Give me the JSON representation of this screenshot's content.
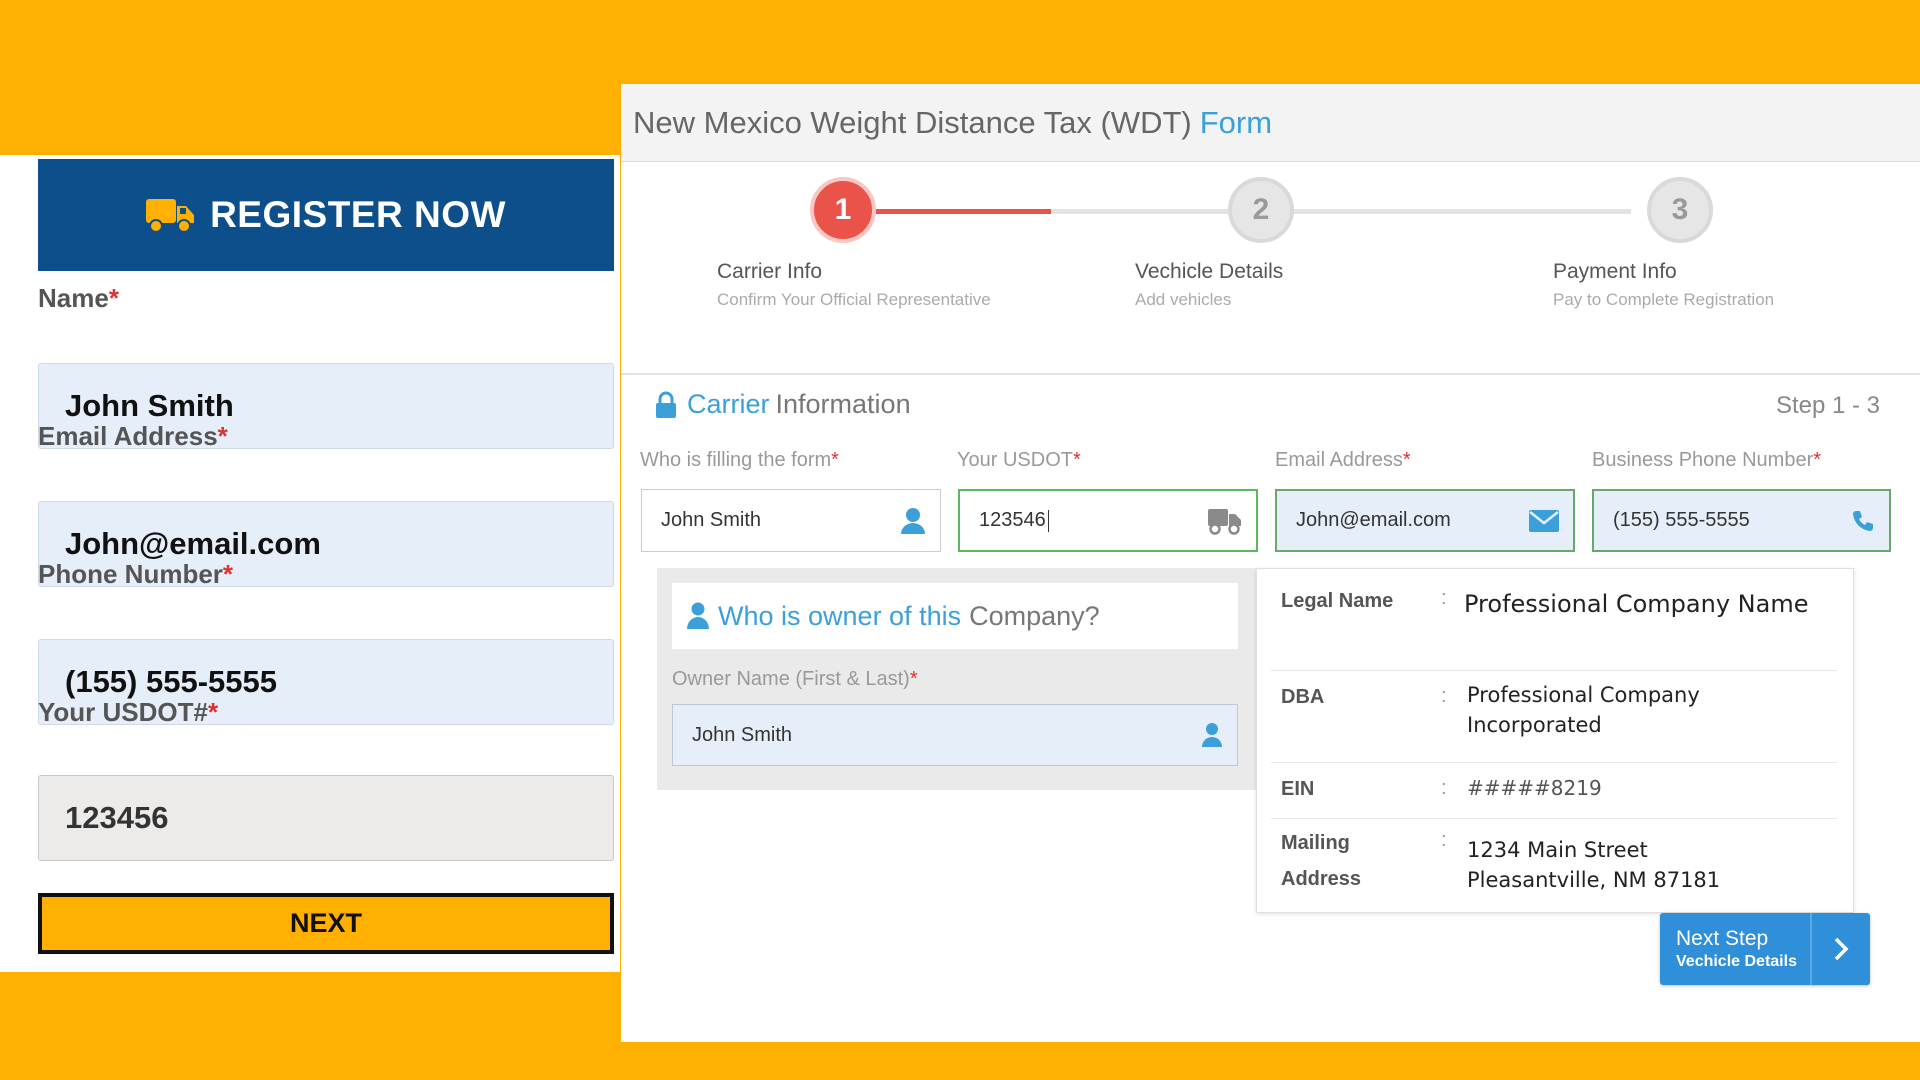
{
  "register": {
    "title": "REGISTER NOW",
    "icon": "truck-icon",
    "name_label": "Name",
    "name_value": "John Smith",
    "email_label": "Email Address",
    "email_value": "John@email.com",
    "phone_label": "Phone Number",
    "phone_value": "(155) 555-5555",
    "usdot_label": "Your USDOT#",
    "usdot_value": "123456",
    "required_mark": "*",
    "next_label": "NEXT"
  },
  "form": {
    "title_prefix": "New Mexico Weight Distance Tax (WDT)",
    "title_suffix": "Form",
    "steps": [
      {
        "number": "1",
        "title": "Carrier Info",
        "subtitle": "Confirm Your Official Representative",
        "active": true
      },
      {
        "number": "2",
        "title": "Vechicle Details",
        "subtitle": "Add vehicles",
        "active": false
      },
      {
        "number": "3",
        "title": "Payment Info",
        "subtitle": "Pay to Complete Registration",
        "active": false
      }
    ],
    "section_title_blue": "Carrier",
    "section_title_gray": "Information",
    "step_count": "Step 1 - 3",
    "fields": {
      "filer_label": "Who is filling the form",
      "filer_value": "John Smith",
      "usdot_label": "Your USDOT",
      "usdot_value": "123546",
      "email_label": "Email Address",
      "email_value": "John@email.com",
      "phone_label": "Business Phone Number",
      "phone_value": "(155) 555-5555"
    },
    "owner": {
      "question_blue": "Who is owner of this",
      "question_gray": "Company?",
      "name_label": "Owner Name (First & Last)",
      "name_value": "John Smith"
    },
    "company": {
      "legal_name_key": "Legal Name",
      "legal_name_value": "Professional Company Name",
      "dba_key": "DBA",
      "dba_value_line1": "Professional Company",
      "dba_value_line2": "Incorporated",
      "ein_key": "EIN",
      "ein_value": "#####8219",
      "mailing_key_line1": "Mailing",
      "mailing_key_line2": "Address",
      "mailing_value_line1": "1234 Main Street",
      "mailing_value_line2": "Pleasantville, NM 87181",
      "colon": ":"
    },
    "next_step": {
      "line1": "Next Step",
      "line2": "Vechicle Details"
    }
  },
  "colors": {
    "background": "#FFB000",
    "banner_blue": "#0d4f8b",
    "accent_blue": "#3ba0d9",
    "active_step": "#e9534a",
    "required": "#e03030",
    "button_blue": "#2f8fd8"
  }
}
